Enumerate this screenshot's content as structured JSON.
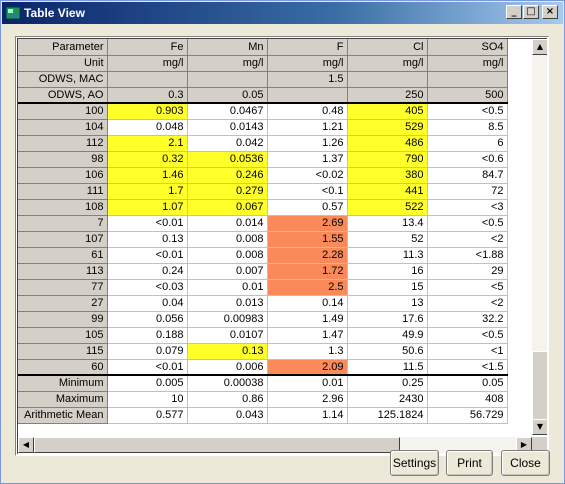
{
  "window": {
    "title": "Table View",
    "icon": "table-view-app-icon",
    "controls": {
      "minimize": "_",
      "maximize": "□",
      "close": "×"
    }
  },
  "colors": {
    "exceed_mac": "#fa8a5a",
    "exceed_ao": "#ffff2a",
    "header_bg": "#d4d0c8"
  },
  "table": {
    "columns": [
      "Parameter",
      "Fe",
      "Mn",
      "F",
      "Cl",
      "SO4"
    ],
    "header_rows": [
      {
        "label": "Unit",
        "cells": [
          "mg/l",
          "mg/l",
          "mg/l",
          "mg/l",
          "mg/l"
        ]
      },
      {
        "label": "ODWS, MAC",
        "cells": [
          "",
          "",
          "1.5",
          "",
          ""
        ]
      },
      {
        "label": "ODWS, AO",
        "cells": [
          "0.3",
          "0.05",
          "",
          "250",
          "500"
        ]
      }
    ],
    "rows": [
      {
        "id": "100",
        "cells": [
          "0.903",
          "0.0467",
          "0.48",
          "405",
          "<0.5"
        ],
        "flags": [
          "yellow",
          "",
          "",
          "yellow",
          ""
        ]
      },
      {
        "id": "104",
        "cells": [
          "0.048",
          "0.0143",
          "1.21",
          "529",
          "8.5"
        ],
        "flags": [
          "",
          "",
          "",
          "yellow",
          ""
        ]
      },
      {
        "id": "112",
        "cells": [
          "2.1",
          "0.042",
          "1.26",
          "486",
          "6"
        ],
        "flags": [
          "yellow",
          "",
          "",
          "yellow",
          ""
        ]
      },
      {
        "id": "98",
        "cells": [
          "0.32",
          "0.0536",
          "1.37",
          "790",
          "<0.6"
        ],
        "flags": [
          "yellow",
          "yellow",
          "",
          "yellow",
          ""
        ]
      },
      {
        "id": "106",
        "cells": [
          "1.46",
          "0.246",
          "<0.02",
          "380",
          "84.7"
        ],
        "flags": [
          "yellow",
          "yellow",
          "",
          "yellow",
          ""
        ]
      },
      {
        "id": "111",
        "cells": [
          "1.7",
          "0.279",
          "<0.1",
          "441",
          "72"
        ],
        "flags": [
          "yellow",
          "yellow",
          "",
          "yellow",
          ""
        ]
      },
      {
        "id": "108",
        "cells": [
          "1.07",
          "0.067",
          "0.57",
          "522",
          "<3"
        ],
        "flags": [
          "yellow",
          "yellow",
          "",
          "yellow",
          ""
        ]
      },
      {
        "id": "7",
        "cells": [
          "<0.01",
          "0.014",
          "2.69",
          "13.4",
          "<0.5"
        ],
        "flags": [
          "",
          "",
          "orange",
          "",
          ""
        ]
      },
      {
        "id": "107",
        "cells": [
          "0.13",
          "0.008",
          "1.55",
          "52",
          "<2"
        ],
        "flags": [
          "",
          "",
          "orange",
          "",
          ""
        ]
      },
      {
        "id": "61",
        "cells": [
          "<0.01",
          "0.008",
          "2.28",
          "11.3",
          "<1.88"
        ],
        "flags": [
          "",
          "",
          "orange",
          "",
          ""
        ]
      },
      {
        "id": "113",
        "cells": [
          "0.24",
          "0.007",
          "1.72",
          "16",
          "29"
        ],
        "flags": [
          "",
          "",
          "orange",
          "",
          ""
        ]
      },
      {
        "id": "77",
        "cells": [
          "<0.03",
          "0.01",
          "2.5",
          "15",
          "<5"
        ],
        "flags": [
          "",
          "",
          "orange",
          "",
          ""
        ]
      },
      {
        "id": "27",
        "cells": [
          "0.04",
          "0.013",
          "0.14",
          "13",
          "<2"
        ],
        "flags": [
          "",
          "",
          "",
          "",
          ""
        ]
      },
      {
        "id": "99",
        "cells": [
          "0.056",
          "0.00983",
          "1.49",
          "17.6",
          "32.2"
        ],
        "flags": [
          "",
          "",
          "",
          "",
          ""
        ]
      },
      {
        "id": "105",
        "cells": [
          "0.188",
          "0.0107",
          "1.47",
          "49.9",
          "<0.5"
        ],
        "flags": [
          "",
          "",
          "",
          "",
          ""
        ]
      },
      {
        "id": "115",
        "cells": [
          "0.079",
          "0.13",
          "1.3",
          "50.6",
          "<1"
        ],
        "flags": [
          "",
          "yellow",
          "",
          "",
          ""
        ]
      },
      {
        "id": "60",
        "cells": [
          "<0.01",
          "0.006",
          "2.09",
          "11.5",
          "<1.5"
        ],
        "flags": [
          "",
          "",
          "orange",
          "",
          ""
        ]
      }
    ],
    "summary_rows": [
      {
        "label": "Minimum",
        "cells": [
          "0.005",
          "0.00038",
          "0.01",
          "0.25",
          "0.05"
        ]
      },
      {
        "label": "Maximum",
        "cells": [
          "10",
          "0.86",
          "2.96",
          "2430",
          "408"
        ]
      },
      {
        "label": "Arithmetic Mean",
        "cells": [
          "0.577",
          "0.043",
          "1.14",
          "125.1824",
          "56.729"
        ]
      }
    ]
  },
  "scrollbars": {
    "vertical": {
      "up": "▲",
      "down": "▼"
    },
    "horizontal": {
      "left": "◀",
      "right": "▶"
    }
  },
  "buttons": {
    "settings": "Settings",
    "print": "Print",
    "close": "Close"
  }
}
